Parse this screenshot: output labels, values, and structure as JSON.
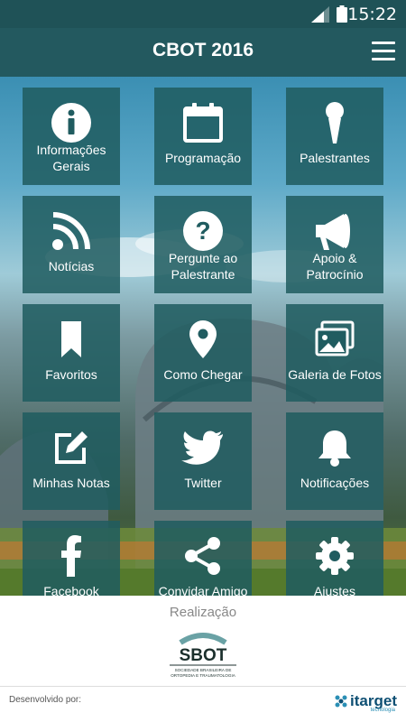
{
  "status": {
    "time": "15:22"
  },
  "app": {
    "title": "CBOT 2016"
  },
  "tiles": [
    {
      "label": "Informações\nGerais",
      "icon": "info-icon"
    },
    {
      "label": "Programação",
      "icon": "calendar-icon"
    },
    {
      "label": "Palestrantes",
      "icon": "microphone-icon"
    },
    {
      "label": "Notícias",
      "icon": "rss-icon"
    },
    {
      "label": "Pergunte ao\nPalestrante",
      "icon": "question-icon"
    },
    {
      "label": "Apoio &\nPatrocínio",
      "icon": "megaphone-icon"
    },
    {
      "label": "Favoritos",
      "icon": "bookmark-icon"
    },
    {
      "label": "Como Chegar",
      "icon": "map-marker-icon"
    },
    {
      "label": "Galeria de Fotos",
      "icon": "photos-icon"
    },
    {
      "label": "Minhas Notas",
      "icon": "edit-icon"
    },
    {
      "label": "Twitter",
      "icon": "twitter-icon"
    },
    {
      "label": "Notificações",
      "icon": "bell-icon"
    },
    {
      "label": "Facebook",
      "icon": "facebook-icon"
    },
    {
      "label": "Convidar Amigo",
      "icon": "share-icon"
    },
    {
      "label": "Ajustes",
      "icon": "settings-icon"
    }
  ],
  "footer": {
    "realizacao": "Realização",
    "sbot_logo": {
      "name": "SBOT",
      "subtitle": "SOCIEDADE BRASILEIRA DE ORTOPEDIA E TRAUMATOLOGIA"
    },
    "developed_by": "Desenvolvido por:",
    "itarget_logo": {
      "name": "itarget",
      "subtitle": "tecnologia"
    }
  },
  "colors": {
    "status_bar": "#1f5257",
    "app_bar": "#23595f",
    "tile": "#205c60"
  }
}
